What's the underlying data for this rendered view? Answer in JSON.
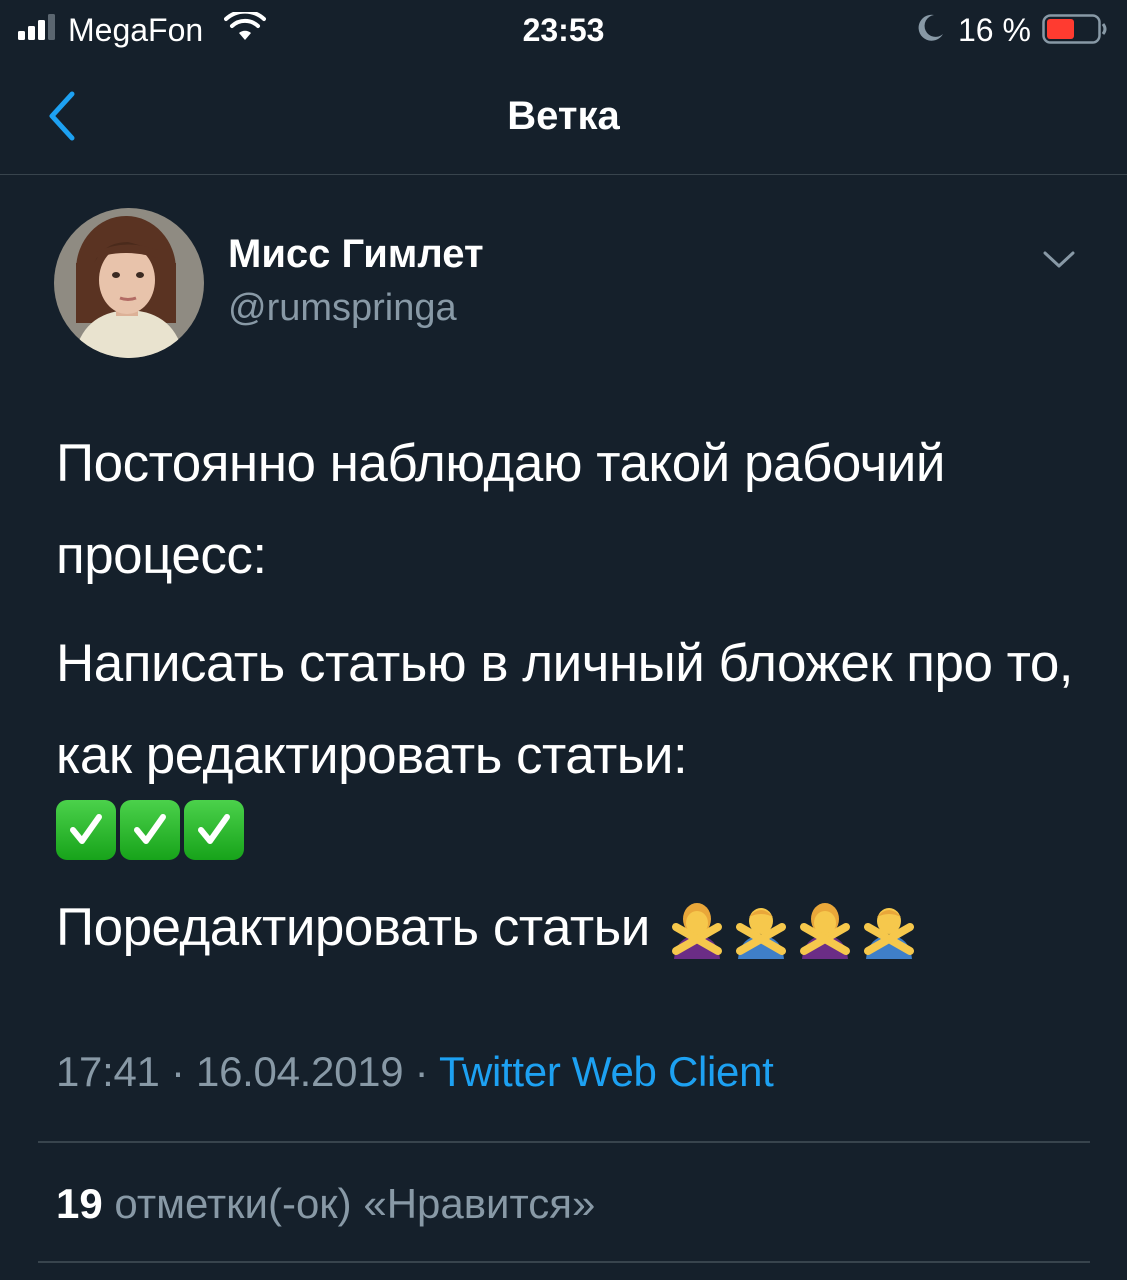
{
  "status_bar": {
    "carrier": "MegaFon",
    "time": "23:53",
    "battery_percent": "16 %",
    "battery_level": 0.16,
    "icons": [
      "signal-icon",
      "wifi-icon",
      "moon-icon",
      "battery-icon"
    ]
  },
  "nav": {
    "title": "Ветка",
    "back_icon": "chevron-left-icon"
  },
  "tweet": {
    "author": {
      "display_name": "Мисс Гимлет",
      "handle": "@rumspringa"
    },
    "menu_icon": "chevron-down-icon",
    "paragraphs": {
      "p1": "Постоянно наблюдаю такой рабочий процесс:",
      "p2": "Написать статью в личный бложек про то, как редактировать статьи:",
      "p3": "Поредактировать статьи"
    },
    "emoji": {
      "checks": [
        "✅",
        "✅",
        "✅"
      ],
      "gestures": [
        "🙅‍♀️",
        "🙅‍♂️",
        "🙅‍♀️",
        "🙅‍♂️"
      ]
    },
    "meta": {
      "time": "17:41",
      "sep1": " · ",
      "date": "16.04.2019",
      "sep2": " · ",
      "source": "Twitter Web Client"
    },
    "likes": {
      "count": "19",
      "label": "отметки(-ок) «Нравится»"
    }
  },
  "colors": {
    "background": "#15202b",
    "accent": "#1da1f2",
    "secondary_text": "#8899a6",
    "divider": "#38444d"
  }
}
